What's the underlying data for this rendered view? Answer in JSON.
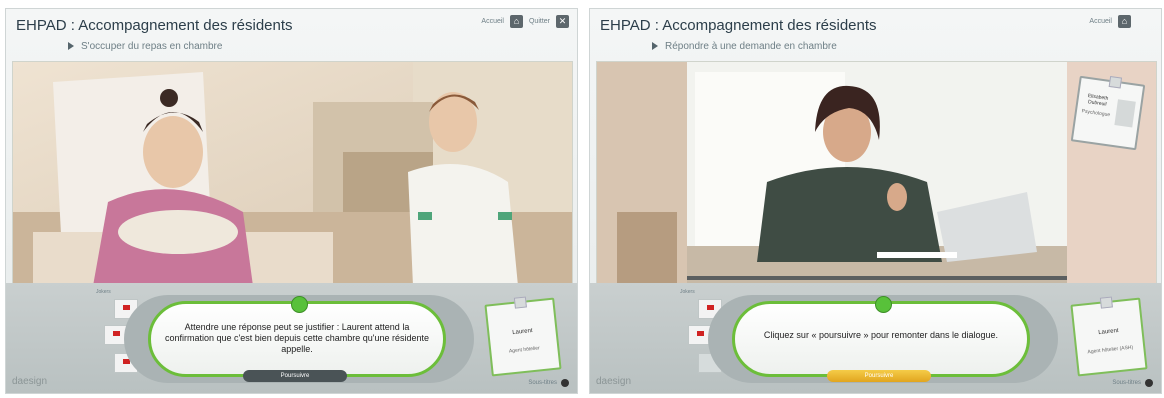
{
  "panels": [
    {
      "title": "EHPAD : Accompagnement des résidents",
      "subtitle": "S'occuper du repas en chambre",
      "top_links": {
        "home": "Accueil",
        "quit": "Quitter"
      },
      "jokers_label": "Jokers",
      "dialog_text": "Attendre une réponse peut se justifier : Laurent attend la confirmation que c'est bien depuis cette chambre qu'une résidente appelle.",
      "continue_label": "Poursuivre",
      "badge": {
        "name": "Laurent",
        "role": "Agent hôtelier"
      },
      "logo": "daesign",
      "subtitles_label": "Sous-titres"
    },
    {
      "title": "EHPAD : Accompagnement des résidents",
      "subtitle": "Répondre à une demande en chambre",
      "top_links": {
        "home": "Accueil"
      },
      "jokers_label": "Jokers",
      "dialog_text": "Cliquez sur « poursuivre » pour remonter dans le dialogue.",
      "continue_label": "Poursuivre",
      "badge": {
        "name": "Laurent",
        "role": "Agent hôtelier (ASH)"
      },
      "expert_badge": {
        "name": "Elisabeth Dubreuil",
        "role": "Psychologue"
      },
      "logo": "daesign",
      "subtitles_label": "Sous-titres"
    }
  ],
  "colors": {
    "accent_green": "#6cbe3a",
    "continue_gold": "#e1a51f",
    "continue_dark": "#4a5356"
  }
}
